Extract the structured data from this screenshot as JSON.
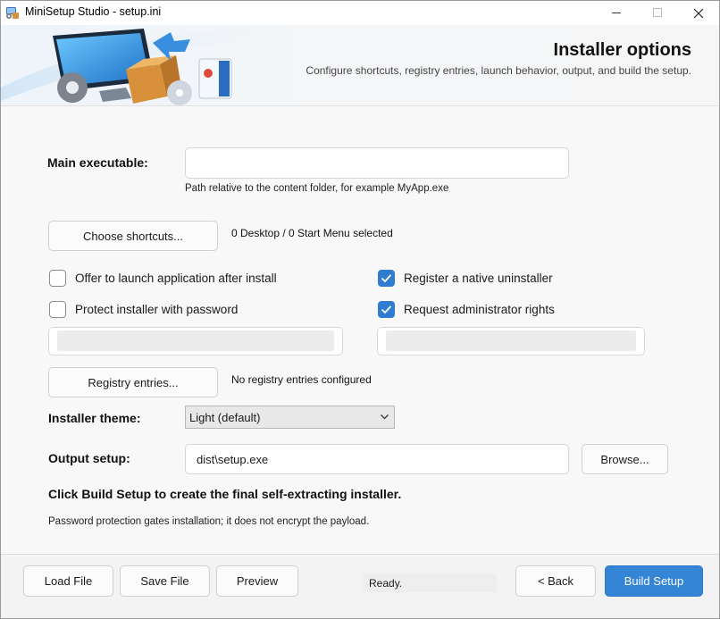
{
  "window": {
    "title": "MiniSetup Studio - setup.ini",
    "controls": {
      "minimize": "—",
      "maximize": "☐",
      "close": "✕"
    }
  },
  "banner": {
    "title": "Installer options",
    "subtitle": "Configure shortcuts, registry entries, launch behavior, output, and build the setup."
  },
  "main_exe": {
    "label": "Main executable:",
    "value": "",
    "hint": "Path relative to the content folder, for example MyApp.exe"
  },
  "shortcuts": {
    "button_label": "Choose shortcuts...",
    "status": "0 Desktop / 0 Start Menu selected"
  },
  "options": {
    "launch_after_install": {
      "label": "Offer to launch application after install",
      "checked": false
    },
    "protect_password": {
      "label": "Protect installer with password",
      "checked": false
    },
    "native_uninstaller": {
      "label": "Register a native uninstaller",
      "checked": true
    },
    "admin_rights": {
      "label": "Request administrator rights",
      "checked": true
    }
  },
  "registry": {
    "button_label": "Registry entries...",
    "status": "No registry entries configured"
  },
  "theme": {
    "label": "Installer theme:",
    "selected": "Light (default)"
  },
  "output": {
    "label": "Output setup:",
    "value": "dist\\setup.exe",
    "browse_label": "Browse..."
  },
  "info": {
    "build_hint": "Click Build Setup to create the final self-extracting installer.",
    "password_note": "Password protection gates installation; it does not encrypt the payload."
  },
  "footer": {
    "load_label": "Load File",
    "save_label": "Save File",
    "preview_label": "Preview",
    "status": "Ready.",
    "back_label": "< Back",
    "build_label": "Build Setup"
  },
  "colors": {
    "accent": "#3585d6",
    "checkbox_checked": "#2f7dd0"
  }
}
